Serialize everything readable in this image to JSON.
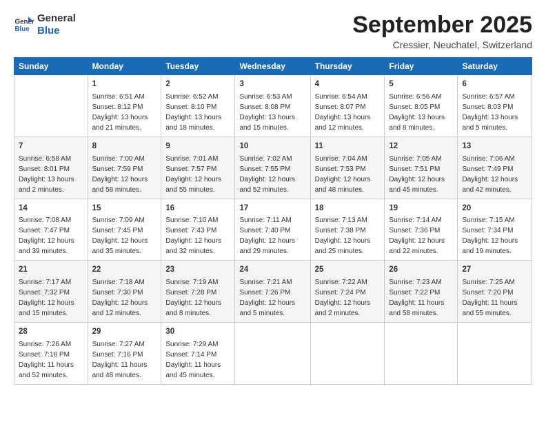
{
  "logo": {
    "line1": "General",
    "line2": "Blue"
  },
  "title": "September 2025",
  "subtitle": "Cressier, Neuchatel, Switzerland",
  "days_header": [
    "Sunday",
    "Monday",
    "Tuesday",
    "Wednesday",
    "Thursday",
    "Friday",
    "Saturday"
  ],
  "weeks": [
    [
      {
        "num": "",
        "info": ""
      },
      {
        "num": "1",
        "info": "Sunrise: 6:51 AM\nSunset: 8:12 PM\nDaylight: 13 hours\nand 21 minutes."
      },
      {
        "num": "2",
        "info": "Sunrise: 6:52 AM\nSunset: 8:10 PM\nDaylight: 13 hours\nand 18 minutes."
      },
      {
        "num": "3",
        "info": "Sunrise: 6:53 AM\nSunset: 8:08 PM\nDaylight: 13 hours\nand 15 minutes."
      },
      {
        "num": "4",
        "info": "Sunrise: 6:54 AM\nSunset: 8:07 PM\nDaylight: 13 hours\nand 12 minutes."
      },
      {
        "num": "5",
        "info": "Sunrise: 6:56 AM\nSunset: 8:05 PM\nDaylight: 13 hours\nand 8 minutes."
      },
      {
        "num": "6",
        "info": "Sunrise: 6:57 AM\nSunset: 8:03 PM\nDaylight: 13 hours\nand 5 minutes."
      }
    ],
    [
      {
        "num": "7",
        "info": "Sunrise: 6:58 AM\nSunset: 8:01 PM\nDaylight: 13 hours\nand 2 minutes."
      },
      {
        "num": "8",
        "info": "Sunrise: 7:00 AM\nSunset: 7:59 PM\nDaylight: 12 hours\nand 58 minutes."
      },
      {
        "num": "9",
        "info": "Sunrise: 7:01 AM\nSunset: 7:57 PM\nDaylight: 12 hours\nand 55 minutes."
      },
      {
        "num": "10",
        "info": "Sunrise: 7:02 AM\nSunset: 7:55 PM\nDaylight: 12 hours\nand 52 minutes."
      },
      {
        "num": "11",
        "info": "Sunrise: 7:04 AM\nSunset: 7:53 PM\nDaylight: 12 hours\nand 48 minutes."
      },
      {
        "num": "12",
        "info": "Sunrise: 7:05 AM\nSunset: 7:51 PM\nDaylight: 12 hours\nand 45 minutes."
      },
      {
        "num": "13",
        "info": "Sunrise: 7:06 AM\nSunset: 7:49 PM\nDaylight: 12 hours\nand 42 minutes."
      }
    ],
    [
      {
        "num": "14",
        "info": "Sunrise: 7:08 AM\nSunset: 7:47 PM\nDaylight: 12 hours\nand 39 minutes."
      },
      {
        "num": "15",
        "info": "Sunrise: 7:09 AM\nSunset: 7:45 PM\nDaylight: 12 hours\nand 35 minutes."
      },
      {
        "num": "16",
        "info": "Sunrise: 7:10 AM\nSunset: 7:43 PM\nDaylight: 12 hours\nand 32 minutes."
      },
      {
        "num": "17",
        "info": "Sunrise: 7:11 AM\nSunset: 7:40 PM\nDaylight: 12 hours\nand 29 minutes."
      },
      {
        "num": "18",
        "info": "Sunrise: 7:13 AM\nSunset: 7:38 PM\nDaylight: 12 hours\nand 25 minutes."
      },
      {
        "num": "19",
        "info": "Sunrise: 7:14 AM\nSunset: 7:36 PM\nDaylight: 12 hours\nand 22 minutes."
      },
      {
        "num": "20",
        "info": "Sunrise: 7:15 AM\nSunset: 7:34 PM\nDaylight: 12 hours\nand 19 minutes."
      }
    ],
    [
      {
        "num": "21",
        "info": "Sunrise: 7:17 AM\nSunset: 7:32 PM\nDaylight: 12 hours\nand 15 minutes."
      },
      {
        "num": "22",
        "info": "Sunrise: 7:18 AM\nSunset: 7:30 PM\nDaylight: 12 hours\nand 12 minutes."
      },
      {
        "num": "23",
        "info": "Sunrise: 7:19 AM\nSunset: 7:28 PM\nDaylight: 12 hours\nand 8 minutes."
      },
      {
        "num": "24",
        "info": "Sunrise: 7:21 AM\nSunset: 7:26 PM\nDaylight: 12 hours\nand 5 minutes."
      },
      {
        "num": "25",
        "info": "Sunrise: 7:22 AM\nSunset: 7:24 PM\nDaylight: 12 hours\nand 2 minutes."
      },
      {
        "num": "26",
        "info": "Sunrise: 7:23 AM\nSunset: 7:22 PM\nDaylight: 11 hours\nand 58 minutes."
      },
      {
        "num": "27",
        "info": "Sunrise: 7:25 AM\nSunset: 7:20 PM\nDaylight: 11 hours\nand 55 minutes."
      }
    ],
    [
      {
        "num": "28",
        "info": "Sunrise: 7:26 AM\nSunset: 7:18 PM\nDaylight: 11 hours\nand 52 minutes."
      },
      {
        "num": "29",
        "info": "Sunrise: 7:27 AM\nSunset: 7:16 PM\nDaylight: 11 hours\nand 48 minutes."
      },
      {
        "num": "30",
        "info": "Sunrise: 7:29 AM\nSunset: 7:14 PM\nDaylight: 11 hours\nand 45 minutes."
      },
      {
        "num": "",
        "info": ""
      },
      {
        "num": "",
        "info": ""
      },
      {
        "num": "",
        "info": ""
      },
      {
        "num": "",
        "info": ""
      }
    ]
  ]
}
